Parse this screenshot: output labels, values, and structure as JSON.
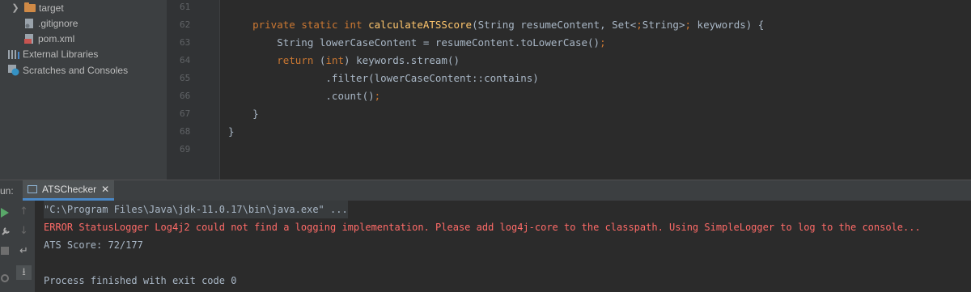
{
  "project_tree": {
    "items": [
      {
        "label": "target",
        "icon": "folder-icon"
      },
      {
        "label": ".gitignore",
        "icon": "gitignore-file-icon"
      },
      {
        "label": "pom.xml",
        "icon": "maven-file-icon"
      },
      {
        "label": "External Libraries",
        "icon": "libraries-icon"
      },
      {
        "label": "Scratches and Consoles",
        "icon": "scratches-icon"
      }
    ]
  },
  "editor": {
    "line_numbers": [
      "61",
      "62",
      "63",
      "64",
      "65",
      "66",
      "67",
      "68",
      "69"
    ],
    "lines": [
      "",
      "    private static int calculateATSScore(String resumeContent, Set<String> keywords) {",
      "        String lowerCaseContent = resumeContent.toLowerCase();",
      "        return (int) keywords.stream()",
      "                .filter(lowerCaseContent::contains)",
      "                .count();",
      "    }",
      "}",
      ""
    ]
  },
  "run_panel": {
    "label": "un:",
    "tab_title": "ATSChecker",
    "console": {
      "command": "\"C:\\Program Files\\Java\\jdk-11.0.17\\bin\\java.exe\" ...",
      "error": "ERROR StatusLogger Log4j2 could not find a logging implementation. Please add log4j-core to the classpath. Using SimpleLogger to log to the console...",
      "score": "ATS Score: 72/177",
      "finished": "Process finished with exit code 0"
    }
  },
  "colors": {
    "keyword": "#cc7832",
    "error": "#ff6b68",
    "text": "#a9b7c6"
  }
}
